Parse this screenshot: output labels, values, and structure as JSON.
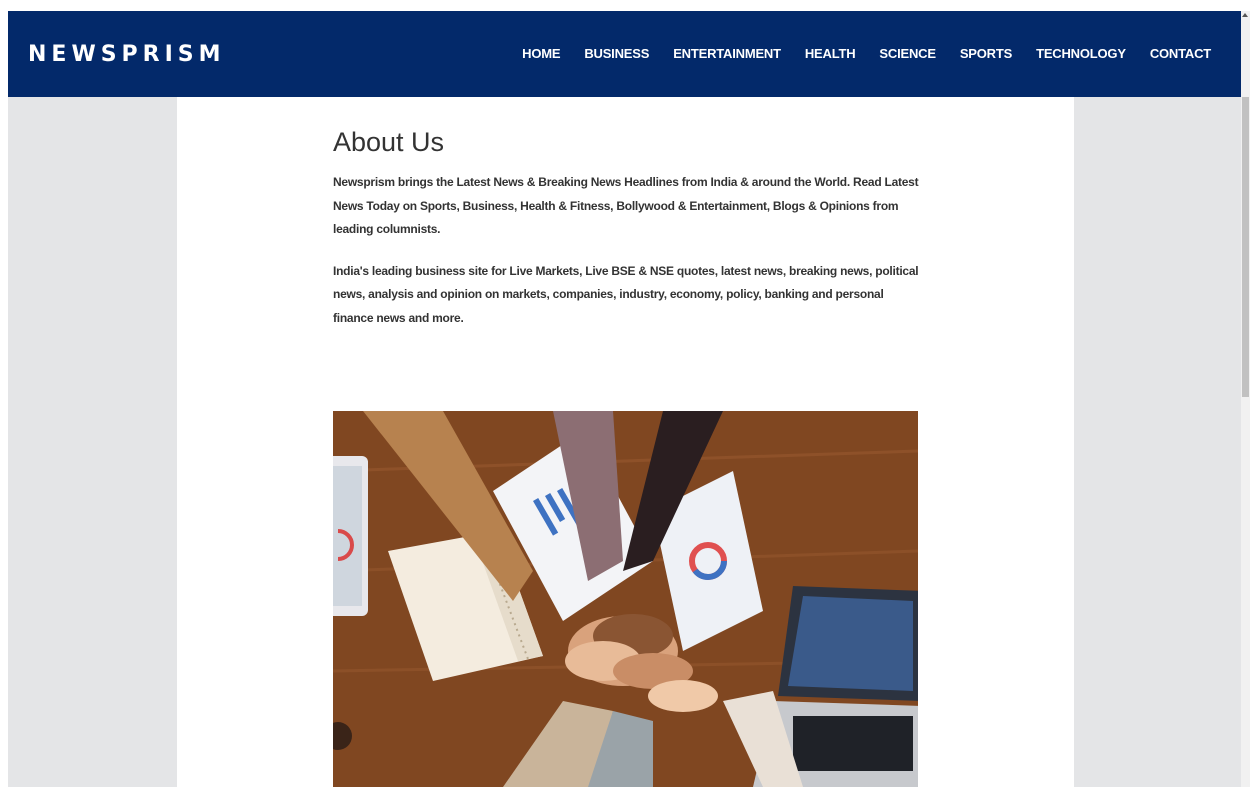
{
  "header": {
    "brand": "NEWSPRISM",
    "nav": [
      {
        "label": "HOME"
      },
      {
        "label": "BUSINESS"
      },
      {
        "label": "ENTERTAINMENT"
      },
      {
        "label": "HEALTH"
      },
      {
        "label": "SCIENCE"
      },
      {
        "label": "SPORTS"
      },
      {
        "label": "TECHNOLOGY"
      },
      {
        "label": "CONTACT"
      }
    ]
  },
  "main": {
    "title": "About Us",
    "paragraphs": [
      "Newsprism brings the Latest News & Breaking News Headlines from India & around the World. Read Latest News Today on Sports, Business, Health & Fitness, Bollywood & Entertainment, Blogs & Opinions from leading columnists.",
      "India's leading business site for Live Markets, Live BSE & NSE quotes, latest news, breaking news, political news, analysis and opinion on markets, companies, industry, economy, policy, banking and personal finance news and more."
    ],
    "image": {
      "description_icon": "team-hands-photo"
    }
  },
  "colors": {
    "nav_bg": "#03296a",
    "page_bg": "#e4e5e7",
    "content_bg": "#ffffff",
    "text": "#333333"
  }
}
